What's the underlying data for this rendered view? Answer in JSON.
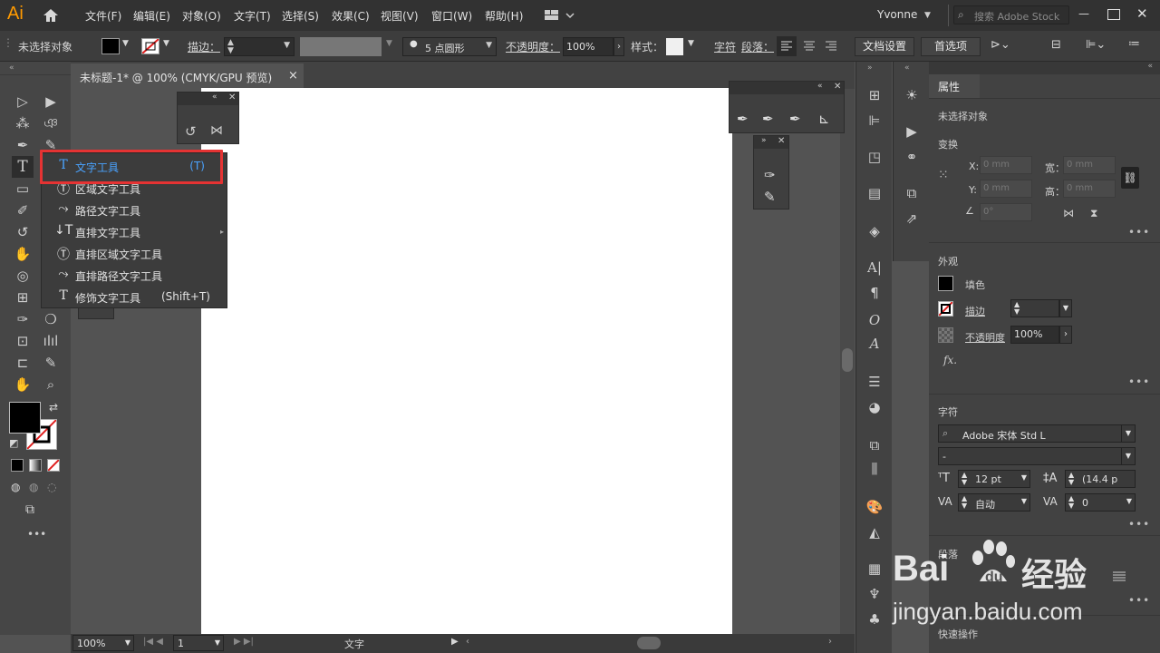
{
  "app": {
    "logo": "Ai"
  },
  "menu": [
    "文件(F)",
    "编辑(E)",
    "对象(O)",
    "文字(T)",
    "选择(S)",
    "效果(C)",
    "视图(V)",
    "窗口(W)",
    "帮助(H)"
  ],
  "user": "Yvonne",
  "search_placeholder": "搜索 Adobe Stock",
  "control": {
    "no_selection": "未选择对象",
    "stroke_label": "描边：",
    "brush": "5 点圆形",
    "opacity_label": "不透明度：",
    "opacity_value": "100%",
    "style_label": "样式：",
    "char_label": "字符",
    "para_label": "段落：",
    "doc_setup": "文档设置",
    "prefs": "首选项"
  },
  "doc_tab": {
    "title": "未标题-1* @ 100% (CMYK/GPU 预览)",
    "close": "×"
  },
  "type_flyout": {
    "items": [
      {
        "icon": "T",
        "label": "文字工具",
        "shortcut": "(T)"
      },
      {
        "icon": "Ⓣ",
        "label": "区域文字工具",
        "shortcut": ""
      },
      {
        "icon": "⤳",
        "label": "路径文字工具",
        "shortcut": ""
      },
      {
        "icon": "↓T",
        "label": "直排文字工具",
        "shortcut": ""
      },
      {
        "icon": "Ⓣ",
        "label": "直排区域文字工具",
        "shortcut": ""
      },
      {
        "icon": "⤳",
        "label": "直排路径文字工具",
        "shortcut": ""
      },
      {
        "icon": "T",
        "label": "修饰文字工具",
        "shortcut": "(Shift+T)"
      }
    ]
  },
  "status": {
    "zoom": "100%",
    "page": "1",
    "tool": "文字"
  },
  "properties": {
    "tab": "属性",
    "no_selection": "未选择对象",
    "transform": {
      "title": "变换",
      "x_label": "X:",
      "y_label": "Y:",
      "w_label": "宽：",
      "h_label": "高：",
      "x": "0 mm",
      "y": "0 mm",
      "w": "0 mm",
      "h": "0 mm",
      "angle": "0°"
    },
    "appearance": {
      "title": "外观",
      "fill": "填色",
      "stroke": "描边",
      "opacity": "不透明度",
      "opacity_value": "100%",
      "fx": "fx."
    },
    "character": {
      "title": "字符",
      "font": "Adobe 宋体 Std L",
      "style": "-",
      "size": "12 pt",
      "leading": "(14.4 p",
      "kerning": "自动",
      "tracking": "0"
    },
    "paragraph": {
      "title": "段落"
    },
    "quick": "快速操作",
    "more": "•••"
  },
  "watermark": {
    "brand": "Bai",
    "brand2": "经验",
    "url": "jingyan.baidu.com"
  }
}
